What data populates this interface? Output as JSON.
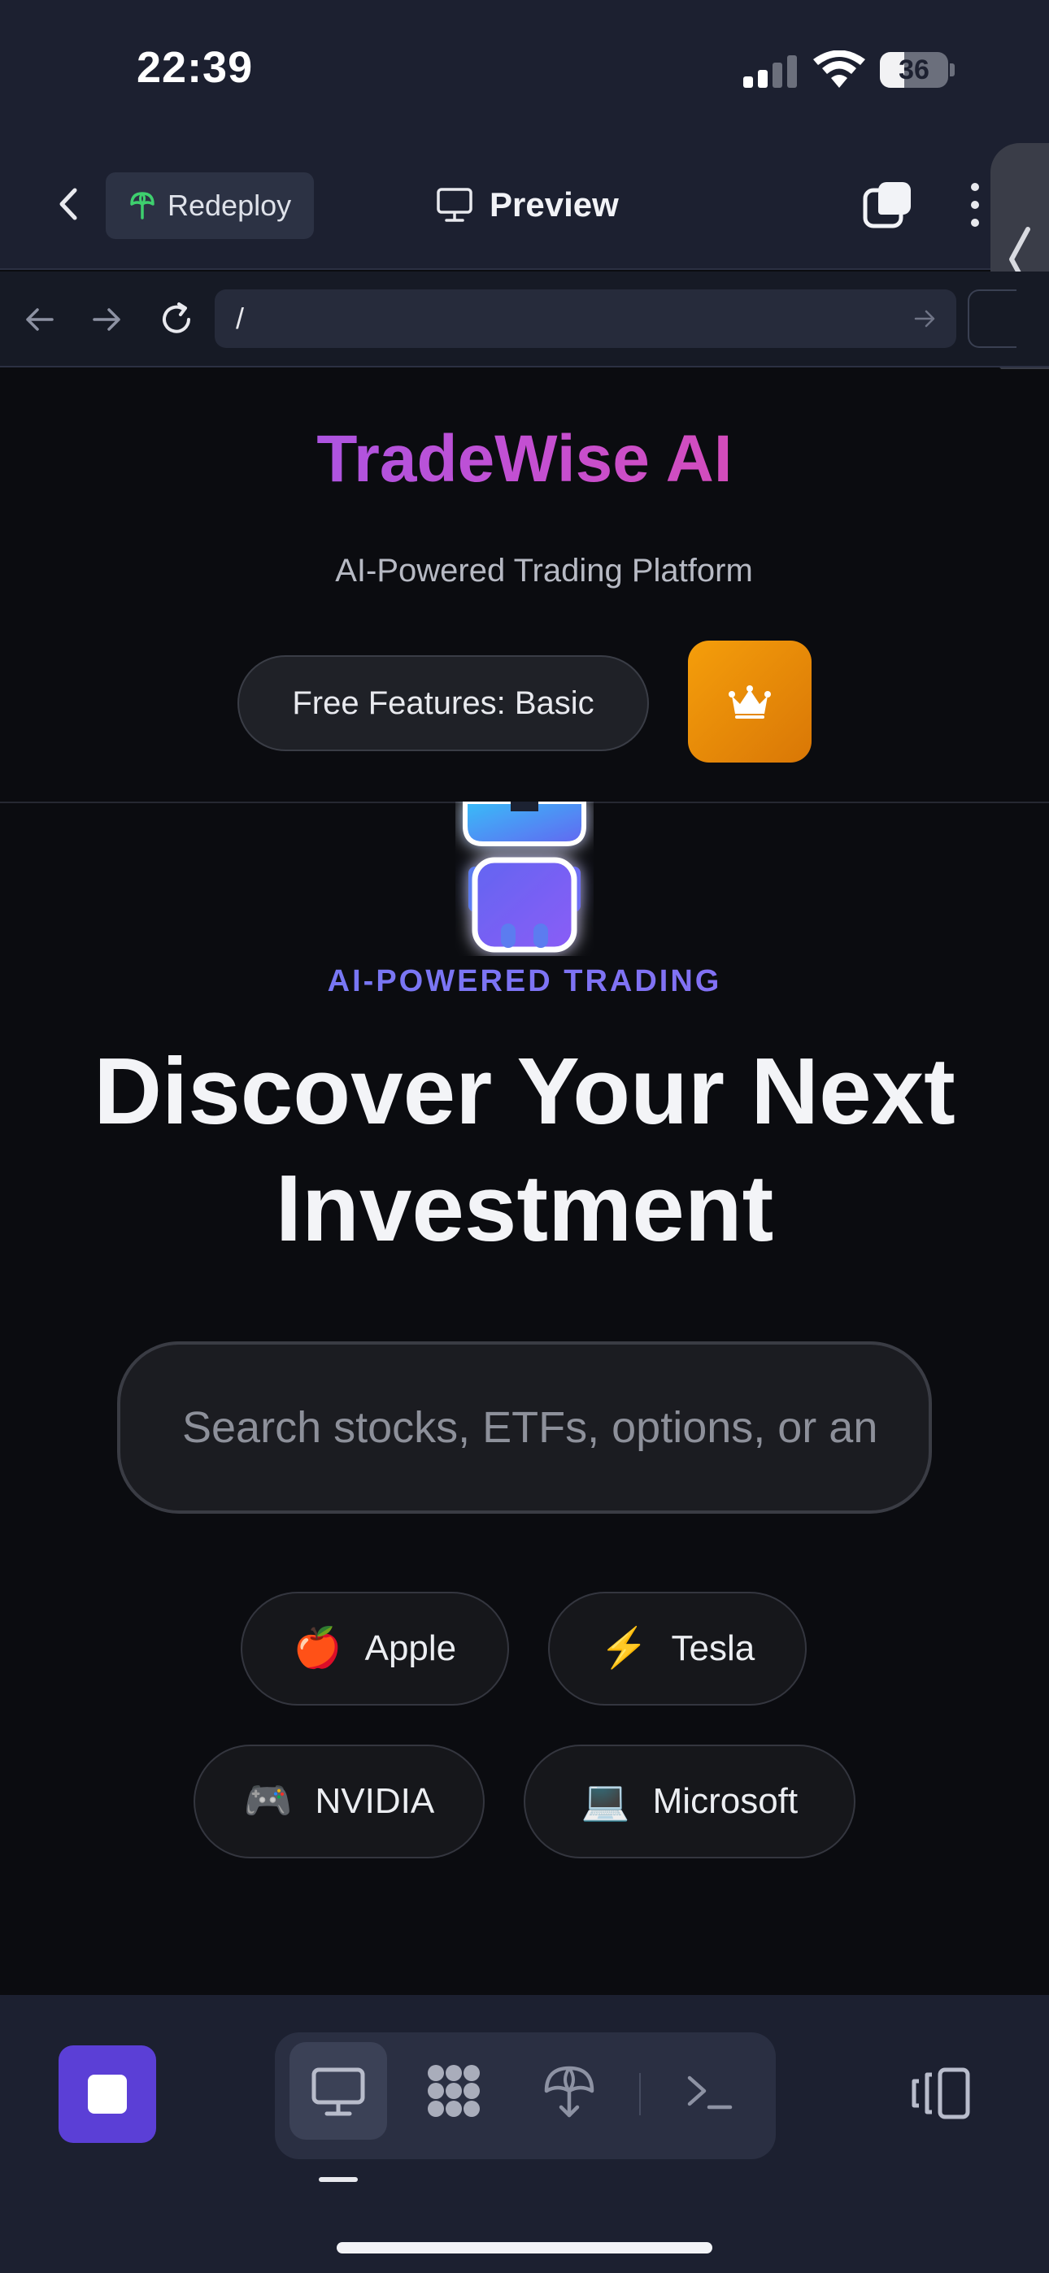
{
  "status_bar": {
    "time": "22:39",
    "battery": "36",
    "battery_level": 0.36
  },
  "toolbar": {
    "redeploy_label": "Redeploy",
    "preview_label": "Preview"
  },
  "browser": {
    "url": "/"
  },
  "header": {
    "title": "TradeWise AI",
    "subtitle": "AI-Powered Trading Platform",
    "tier_label": "Free Features: Basic",
    "premium_icon": "crown-icon"
  },
  "hero": {
    "eyebrow": "AI-POWERED TRADING",
    "title_line1": "Discover Your Next",
    "title_line2": "Investment",
    "search_placeholder": "Search stocks, ETFs, options, or analysis..."
  },
  "quick_picks": [
    {
      "emoji": "🍎",
      "label": "Apple"
    },
    {
      "emoji": "⚡",
      "label": "Tesla"
    },
    {
      "emoji": "🎮",
      "label": "NVIDIA"
    },
    {
      "emoji": "💻",
      "label": "Microsoft"
    }
  ],
  "bottom_bar": {
    "modes": [
      "desktop-icon",
      "apps-icon",
      "deploy-icon",
      "terminal-icon"
    ],
    "active_mode": "desktop-icon"
  },
  "colors": {
    "accent_purple": "#5b3fd6",
    "premium_orange": "#f59e0b",
    "brand_gradient_start": "#8b5cf6",
    "brand_gradient_end": "#ec4899"
  }
}
